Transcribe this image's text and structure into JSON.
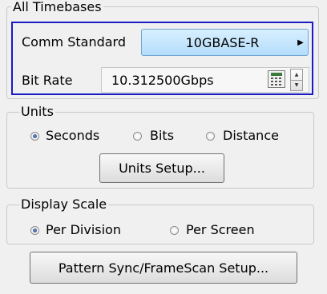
{
  "timebases": {
    "title": "All Timebases",
    "comm_label": "Comm Standard",
    "comm_value": "10GBASE-R",
    "bitrate_label": "Bit Rate",
    "bitrate_value": "10.312500Gbps"
  },
  "units": {
    "title": "Units",
    "options": [
      "Seconds",
      "Bits",
      "Distance"
    ],
    "selected": "Seconds",
    "setup_button": "Units Setup..."
  },
  "display_scale": {
    "title": "Display Scale",
    "options": [
      "Per Division",
      "Per Screen"
    ],
    "selected": "Per Division"
  },
  "pattern_button": "Pattern Sync/FrameScan Setup...",
  "icons": {
    "comm_arrow": "triangle-right-icon",
    "calculator": "calculator-icon",
    "spin_up": "spin-up-icon",
    "spin_down": "spin-down-icon"
  },
  "colors": {
    "highlight_border": "#1a1ac6",
    "comm_button": "#c6e6fd"
  }
}
